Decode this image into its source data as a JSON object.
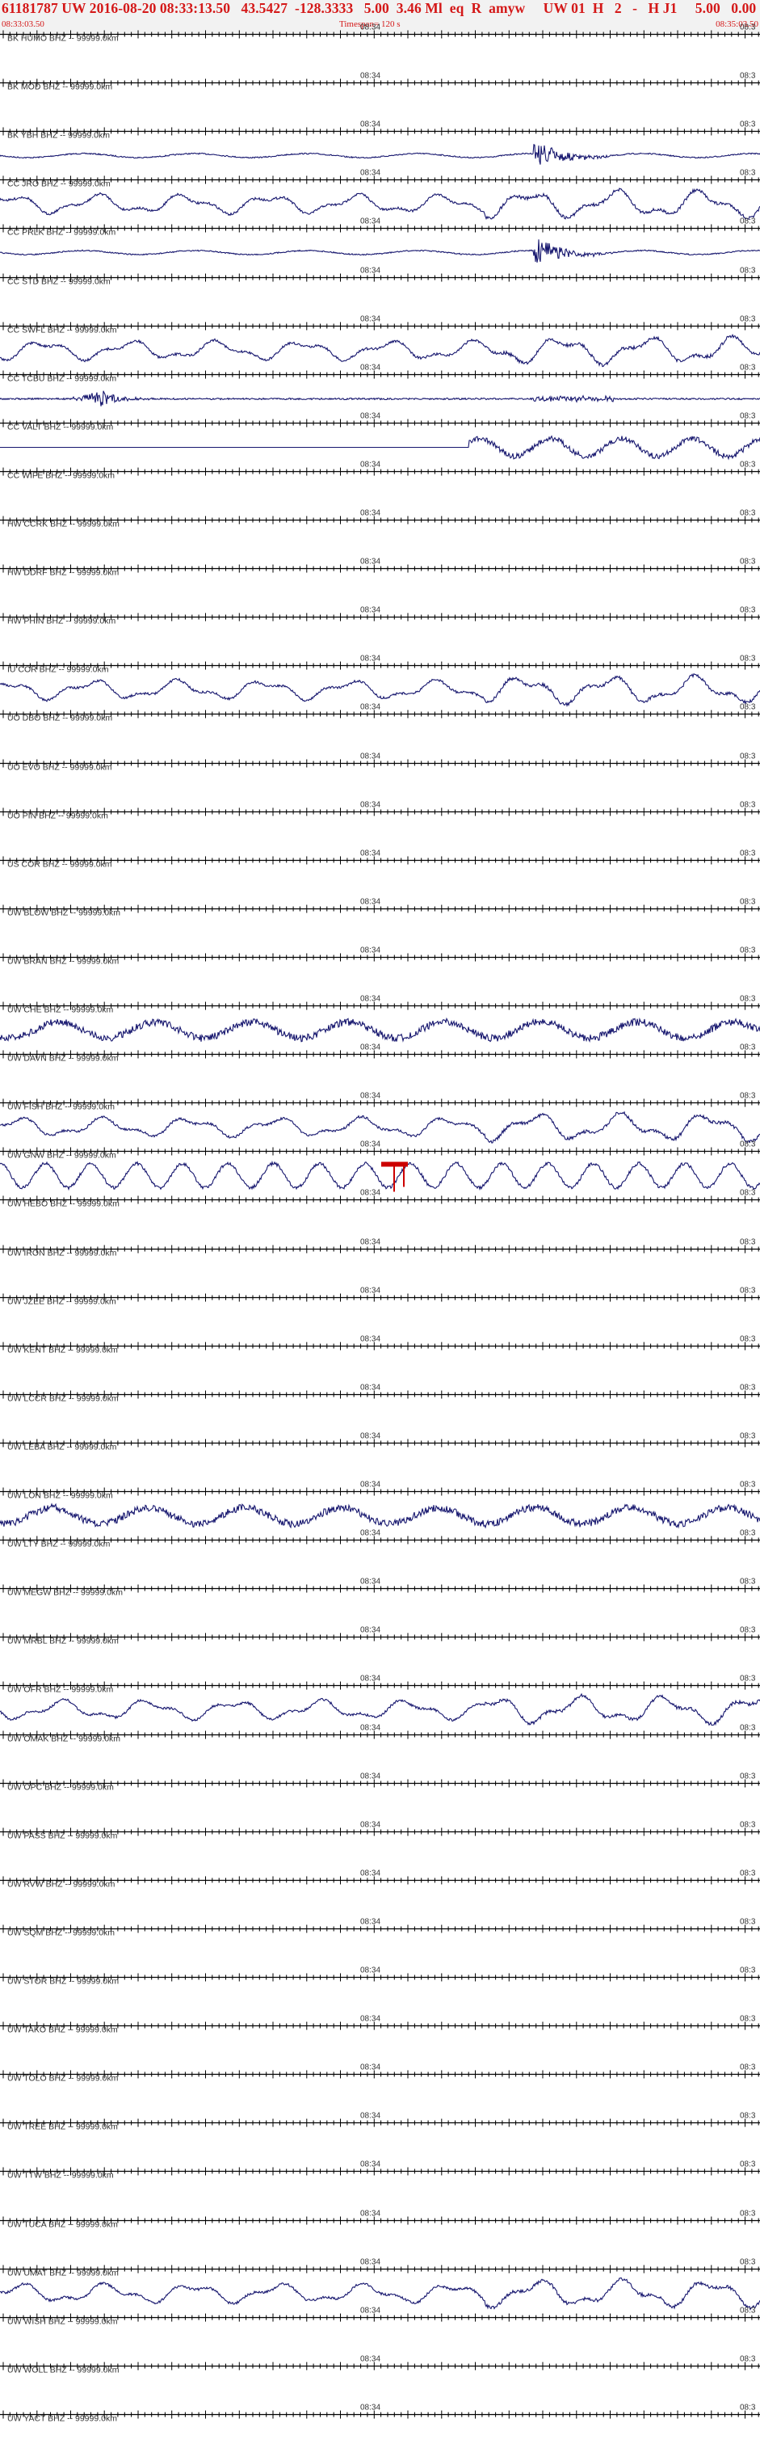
{
  "header": {
    "title": "61181787 UW 2016-08-20 08:33:13.50   43.5427  -128.3333   5.00  3.46 Ml  eq  R  amyw     UW 01  H   2   -   H J1     5.00   0.00",
    "start_time": "08:33:03.50",
    "timespan": "Timespan= 120 s",
    "end_time": "08:35:03.50"
  },
  "colors": {
    "header_text": "#d41818",
    "trace": "#16166e",
    "pick": "#cc0000",
    "axis": "#000000",
    "label": "#333333"
  },
  "time_tick_label": "08:34",
  "time_tick_label_right": "08:3",
  "stations": [
    {
      "label": "BK HUMO BHZ -- 99999.0km",
      "trace": "flat"
    },
    {
      "label": "BK MOD BHZ -- 99999.0km",
      "trace": "flat"
    },
    {
      "label": "BK YBH BHZ -- 99999.0km",
      "trace": "event"
    },
    {
      "label": "CC JRO BHZ -- 99999.0km",
      "trace": "wavy"
    },
    {
      "label": "CC PRLK BHZ -- 99999.0km",
      "trace": "event"
    },
    {
      "label": "CC STD BHZ -- 99999.0km",
      "trace": "flat"
    },
    {
      "label": "CC SWFL BHZ -- 99999.0km",
      "trace": "wavy"
    },
    {
      "label": "CC TCBU BHZ -- 99999.0km",
      "trace": "burst"
    },
    {
      "label": "CC VALT BHZ -- 99999.0km",
      "trace": "late"
    },
    {
      "label": "CC WIFE BHZ -- 99999.0km",
      "trace": "flat"
    },
    {
      "label": "HW CCRK BHZ -- 99999.0km",
      "trace": "flat"
    },
    {
      "label": "HW DDRF BHZ -- 99999.0km",
      "trace": "flat"
    },
    {
      "label": "HW PHIN BHZ -- 99999.0km",
      "trace": "flat"
    },
    {
      "label": "IU COR BHZ -- 99999.0km",
      "trace": "wavy"
    },
    {
      "label": "UO DBO BHZ -- 99999.0km",
      "trace": "flat"
    },
    {
      "label": "UO EVO BHZ -- 99999.0km",
      "trace": "flat"
    },
    {
      "label": "UO PIN BHZ -- 99999.0km",
      "trace": "flat"
    },
    {
      "label": "US COR BHZ -- 99999.0km",
      "trace": "flat"
    },
    {
      "label": "UW BLOW BHZ -- 99999.0km",
      "trace": "flat"
    },
    {
      "label": "UW BRAN BHZ -- 99999.0km",
      "trace": "flat"
    },
    {
      "label": "UW CHE BHZ -- 99999.0km",
      "trace": "noisy"
    },
    {
      "label": "UW DAVN BHZ -- 99999.0km",
      "trace": "flat"
    },
    {
      "label": "UW FISH BHZ -- 99999.0km",
      "trace": "wavy"
    },
    {
      "label": "UW GNW BHZ -- 99999.0km",
      "trace": "pick"
    },
    {
      "label": "UW HEBO BHZ -- 99999.0km",
      "trace": "flat"
    },
    {
      "label": "UW IRON BHZ -- 99999.0km",
      "trace": "flat"
    },
    {
      "label": "UW JZEE BHZ -- 99999.0km",
      "trace": "flat"
    },
    {
      "label": "UW KENT BHZ -- 99999.0km",
      "trace": "flat"
    },
    {
      "label": "UW LCCR BHZ -- 99999.0km",
      "trace": "flat"
    },
    {
      "label": "UW LEBA BHZ -- 99999.0km",
      "trace": "flat"
    },
    {
      "label": "UW LON BHZ -- 99999.0km",
      "trace": "noisy"
    },
    {
      "label": "UW LTY BHZ -- 99999.0km",
      "trace": "flat"
    },
    {
      "label": "UW MEGW BHZ -- 99999.0km",
      "trace": "flat"
    },
    {
      "label": "UW MRBL BHZ -- 99999.0km",
      "trace": "flat"
    },
    {
      "label": "UW OFR BHZ -- 99999.0km",
      "trace": "wavy"
    },
    {
      "label": "UW OMAK BHZ -- 99999.0km",
      "trace": "flat"
    },
    {
      "label": "UW OPC BHZ -- 99999.0km",
      "trace": "flat"
    },
    {
      "label": "UW PASS BHZ -- 99999.0km",
      "trace": "flat"
    },
    {
      "label": "UW RVW BHZ -- 99999.0km",
      "trace": "flat"
    },
    {
      "label": "UW SQM BHZ -- 99999.0km",
      "trace": "flat"
    },
    {
      "label": "UW STOR BHZ -- 99999.0km",
      "trace": "flat"
    },
    {
      "label": "UW TAKO BHZ -- 99999.0km",
      "trace": "flat"
    },
    {
      "label": "UW TOLO BHZ -- 99999.0km",
      "trace": "flat"
    },
    {
      "label": "UW TREE BHZ -- 99999.0km",
      "trace": "flat"
    },
    {
      "label": "UW TTW BHZ -- 99999.0km",
      "trace": "flat"
    },
    {
      "label": "UW TUCA BHZ -- 99999.0km",
      "trace": "flat"
    },
    {
      "label": "UW UMAT BHZ -- 99999.0km",
      "trace": "wavy"
    },
    {
      "label": "UW WISH BHZ -- 99999.0km",
      "trace": "flat"
    },
    {
      "label": "UW WOLL BHZ -- 99999.0km",
      "trace": "flat"
    },
    {
      "label": "UW YACT BHZ -- 99999.0km",
      "trace": "flat"
    }
  ]
}
